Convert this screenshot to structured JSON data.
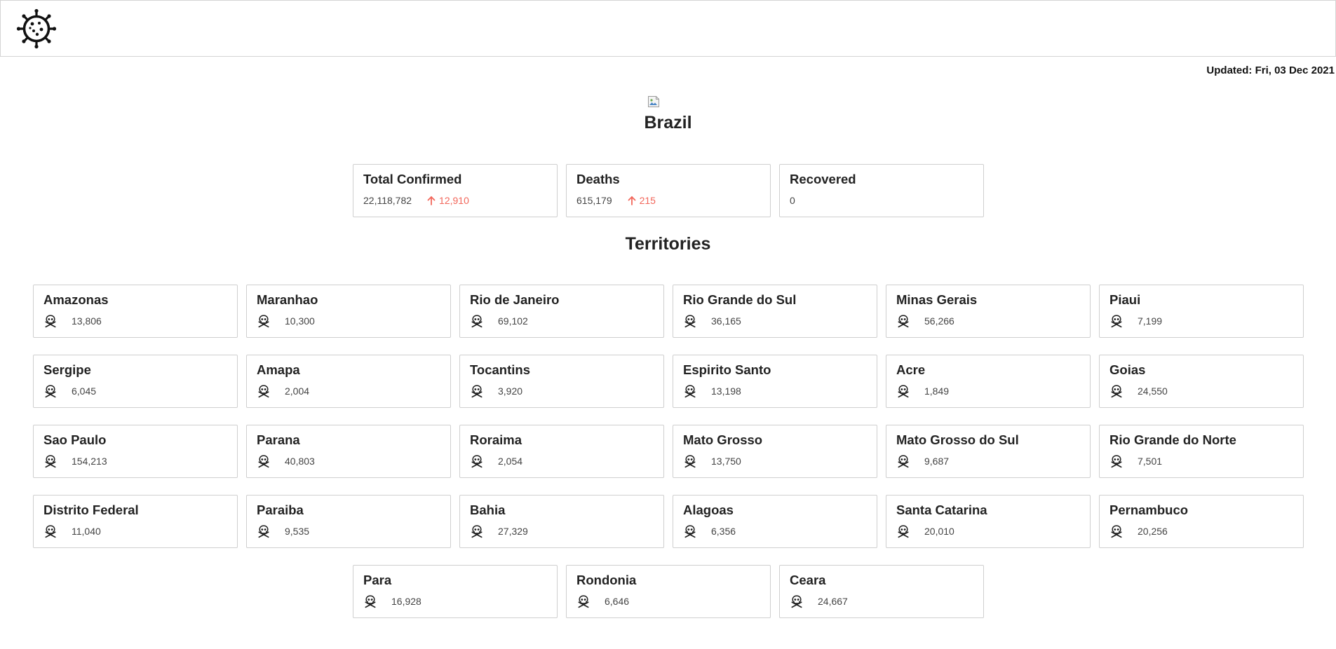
{
  "header": {
    "logo_icon": "virus-icon"
  },
  "updated": "Updated: Fri, 03 Dec 2021",
  "country": {
    "name": "Brazil",
    "flag_icon": "flag-image-icon"
  },
  "summary": {
    "confirmed": {
      "label": "Total Confirmed",
      "value": "22,118,782",
      "delta": "12,910"
    },
    "deaths": {
      "label": "Deaths",
      "value": "615,179",
      "delta": "215"
    },
    "recovered": {
      "label": "Recovered",
      "value": "0"
    }
  },
  "territories_title": "Territories",
  "territory_icon": "skull-crossbones-icon",
  "colors": {
    "delta": "#f2665a",
    "border": "#cfcfcf"
  },
  "territories": [
    {
      "name": "Amazonas",
      "deaths": "13,806"
    },
    {
      "name": "Maranhao",
      "deaths": "10,300"
    },
    {
      "name": "Rio de Janeiro",
      "deaths": "69,102"
    },
    {
      "name": "Rio Grande do Sul",
      "deaths": "36,165"
    },
    {
      "name": "Minas Gerais",
      "deaths": "56,266"
    },
    {
      "name": "Piaui",
      "deaths": "7,199"
    },
    {
      "name": "Sergipe",
      "deaths": "6,045"
    },
    {
      "name": "Amapa",
      "deaths": "2,004"
    },
    {
      "name": "Tocantins",
      "deaths": "3,920"
    },
    {
      "name": "Espirito Santo",
      "deaths": "13,198"
    },
    {
      "name": "Acre",
      "deaths": "1,849"
    },
    {
      "name": "Goias",
      "deaths": "24,550"
    },
    {
      "name": "Sao Paulo",
      "deaths": "154,213"
    },
    {
      "name": "Parana",
      "deaths": "40,803"
    },
    {
      "name": "Roraima",
      "deaths": "2,054"
    },
    {
      "name": "Mato Grosso",
      "deaths": "13,750"
    },
    {
      "name": "Mato Grosso do Sul",
      "deaths": "9,687"
    },
    {
      "name": "Rio Grande do Norte",
      "deaths": "7,501"
    },
    {
      "name": "Distrito Federal",
      "deaths": "11,040"
    },
    {
      "name": "Paraiba",
      "deaths": "9,535"
    },
    {
      "name": "Bahia",
      "deaths": "27,329"
    },
    {
      "name": "Alagoas",
      "deaths": "6,356"
    },
    {
      "name": "Santa Catarina",
      "deaths": "20,010"
    },
    {
      "name": "Pernambuco",
      "deaths": "20,256"
    },
    {
      "name": "Para",
      "deaths": "16,928"
    },
    {
      "name": "Rondonia",
      "deaths": "6,646"
    },
    {
      "name": "Ceara",
      "deaths": "24,667"
    }
  ]
}
